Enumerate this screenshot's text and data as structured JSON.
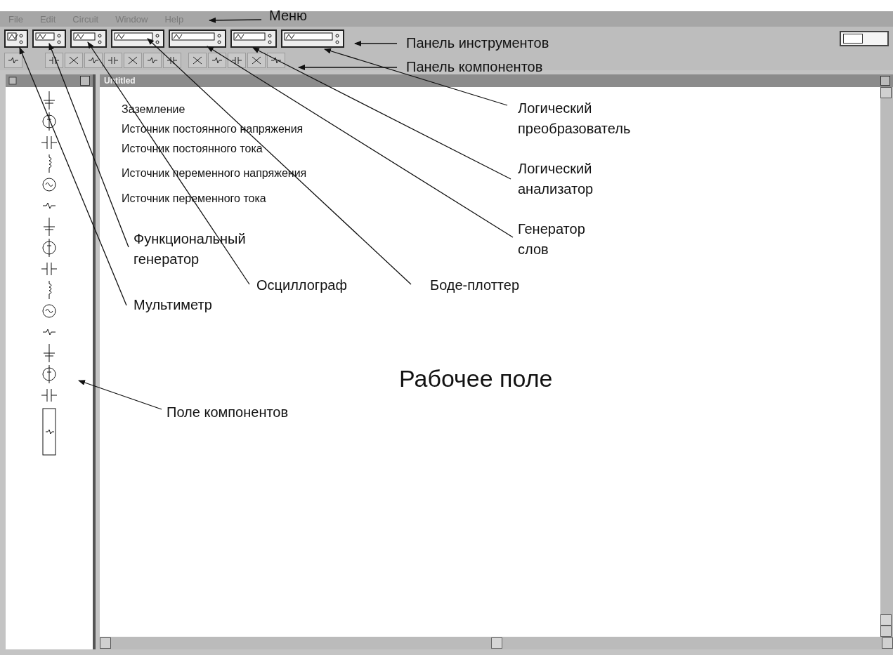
{
  "menu": [
    "File",
    "Edit",
    "Circuit",
    "Window",
    "Help"
  ],
  "power_switch": {
    "on": false
  },
  "window": {
    "title": "Untitled"
  },
  "component_labels": [
    "Заземление",
    "Источник постоянного напряжения",
    "Источник постоянного тока",
    "Источник переменного напряжения",
    "Источник переменного тока"
  ],
  "annotations": [
    {
      "text": "Меню"
    },
    {
      "text": "Панель инструментов"
    },
    {
      "text": "Панель компонентов"
    },
    {
      "text": "Логический преобразователь"
    },
    {
      "text": "Логический анализатор"
    },
    {
      "text": "Генератор слов"
    },
    {
      "text": "Функциональный генератор"
    },
    {
      "text": "Осциллограф"
    },
    {
      "text": "Боде-плоттер"
    },
    {
      "text": "Мультиметр"
    },
    {
      "text": "Рабочее поле"
    },
    {
      "text": "Поле компонентов"
    }
  ]
}
